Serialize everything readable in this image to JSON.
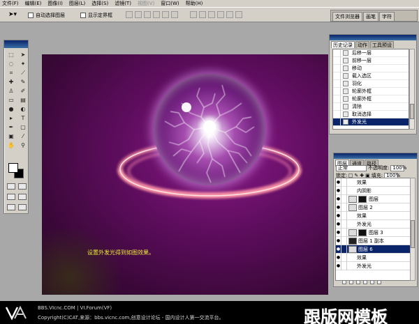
{
  "menu": {
    "items": [
      {
        "label": "文件(F)",
        "disabled": false
      },
      {
        "label": "编辑(E)",
        "disabled": false
      },
      {
        "label": "图像(I)",
        "disabled": false
      },
      {
        "label": "图层(L)",
        "disabled": false
      },
      {
        "label": "选择(S)",
        "disabled": false
      },
      {
        "label": "滤镜(T)",
        "disabled": false
      },
      {
        "label": "视图(V)",
        "disabled": true
      },
      {
        "label": "窗口(W)",
        "disabled": false
      },
      {
        "label": "帮助(H)",
        "disabled": false
      }
    ]
  },
  "options": {
    "auto_select": "自动选择图层",
    "show_bounds": "显示定界框",
    "docked_tabs": [
      "文件浏览器",
      "画笔",
      "字符"
    ]
  },
  "history": {
    "tabs": [
      "历史记录",
      "动作",
      "工具预设"
    ],
    "items": [
      "后移一层",
      "前移一层",
      "移动",
      "载入选区",
      "羽化",
      "轮廓外框",
      "轮廓外框",
      "清除",
      "取消选择",
      "外发光"
    ],
    "selected_index": 9,
    "scroll_fraction": 0.85
  },
  "layers": {
    "tabs": [
      "图层",
      "通道",
      "路径"
    ],
    "blend_mode": "正常",
    "opacity_label": "不透明度:",
    "opacity_value": "100%",
    "lock_label": "锁定:",
    "fill_label": "填充:",
    "fill_value": "100%",
    "rows": [
      {
        "label": "效果",
        "kind": "fx"
      },
      {
        "label": "内阴影",
        "kind": "fx"
      },
      {
        "label": "图层",
        "kind": "layer-mask"
      },
      {
        "label": "图层 2",
        "kind": "layer"
      },
      {
        "label": "效果",
        "kind": "fx"
      },
      {
        "label": "外发光",
        "kind": "fx"
      },
      {
        "label": "图层 3",
        "kind": "layer-mask"
      },
      {
        "label": "图层 1 副本",
        "kind": "layer-dark"
      },
      {
        "label": "图层 6",
        "kind": "layer-selected"
      },
      {
        "label": "效果",
        "kind": "fx"
      },
      {
        "label": "外发光",
        "kind": "fx"
      }
    ]
  },
  "caption": "设置外发光得到如图效果。",
  "banner": {
    "line1": "BBS.VIcnc.COM | VI.Forum(VF)",
    "line2": "Copyright(C)CAT,来源：bbs.vicnc.com,创意设计论坛 - 国内设计人第一交流平台。",
    "watermark": "跟版网模板"
  },
  "colors": {
    "canvas_bg": "#5e0d5e",
    "caption": "#ecec3a",
    "selection": "#0a246a",
    "chrome": "#d4d0c8"
  }
}
